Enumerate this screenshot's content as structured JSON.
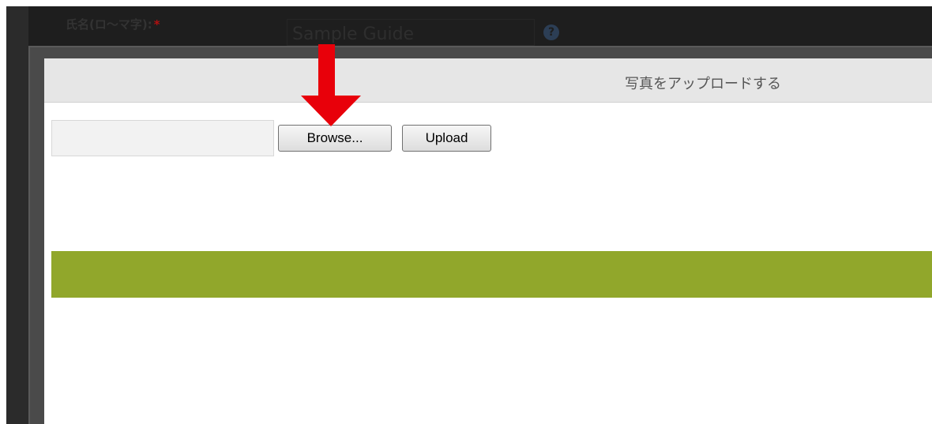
{
  "background_form": {
    "field_label": "氏名(ロ～マ字):",
    "required_marker": "*",
    "field_value": "Sample Guide",
    "help_icon": "?"
  },
  "modal": {
    "title": "写真をアップロードする",
    "file_input_value": "",
    "browse_label": "Browse...",
    "upload_label": "Upload"
  },
  "annotation": {
    "arrow_icon": "down-arrow-icon",
    "arrow_color": "#e8000a"
  },
  "colors": {
    "accent_bar": "#91a72b",
    "overlay": "#1e1e1e"
  }
}
